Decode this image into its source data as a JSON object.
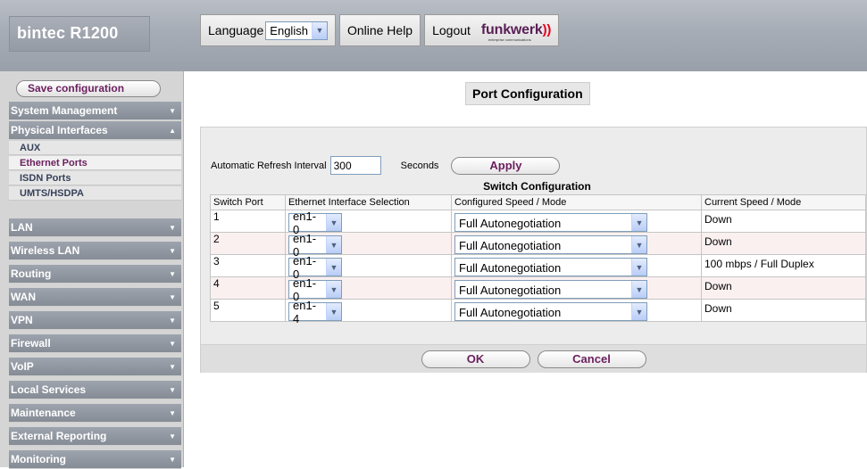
{
  "header": {
    "product": "bintec R1200",
    "language_label": "Language",
    "language_value": "English",
    "online_help": "Online Help",
    "logout": "Logout",
    "logo": "funkwerk",
    "logo_tagline": "enterprise communications"
  },
  "sidebar": {
    "save_label": "Save configuration",
    "items": [
      {
        "label": "System Management"
      },
      {
        "label": "Physical Interfaces"
      },
      {
        "label": "LAN"
      },
      {
        "label": "Wireless LAN"
      },
      {
        "label": "Routing"
      },
      {
        "label": "WAN"
      },
      {
        "label": "VPN"
      },
      {
        "label": "Firewall"
      },
      {
        "label": "VoIP"
      },
      {
        "label": "Local Services"
      },
      {
        "label": "Maintenance"
      },
      {
        "label": "External Reporting"
      },
      {
        "label": "Monitoring"
      }
    ],
    "subitems": [
      {
        "label": "AUX"
      },
      {
        "label": "Ethernet Ports",
        "active": true
      },
      {
        "label": "ISDN Ports"
      },
      {
        "label": "UMTS/HSDPA"
      }
    ]
  },
  "main": {
    "title": "Port Configuration",
    "refresh_label": "Automatic Refresh Interval",
    "refresh_value": "300",
    "seconds_label": "Seconds",
    "apply_label": "Apply",
    "table_caption": "Switch Configuration",
    "columns": [
      "Switch Port",
      "Ethernet Interface Selection",
      "Configured Speed / Mode",
      "Current Speed / Mode"
    ],
    "rows": [
      {
        "port": "1",
        "interface": "en1-0",
        "configured": "Full Autonegotiation",
        "current": "Down"
      },
      {
        "port": "2",
        "interface": "en1-0",
        "configured": "Full Autonegotiation",
        "current": "Down"
      },
      {
        "port": "3",
        "interface": "en1-0",
        "configured": "Full Autonegotiation",
        "current": "100 mbps / Full Duplex"
      },
      {
        "port": "4",
        "interface": "en1-0",
        "configured": "Full Autonegotiation",
        "current": "Down"
      },
      {
        "port": "5",
        "interface": "en1-4",
        "configured": "Full Autonegotiation",
        "current": "Down"
      }
    ],
    "ok_label": "OK",
    "cancel_label": "Cancel"
  }
}
